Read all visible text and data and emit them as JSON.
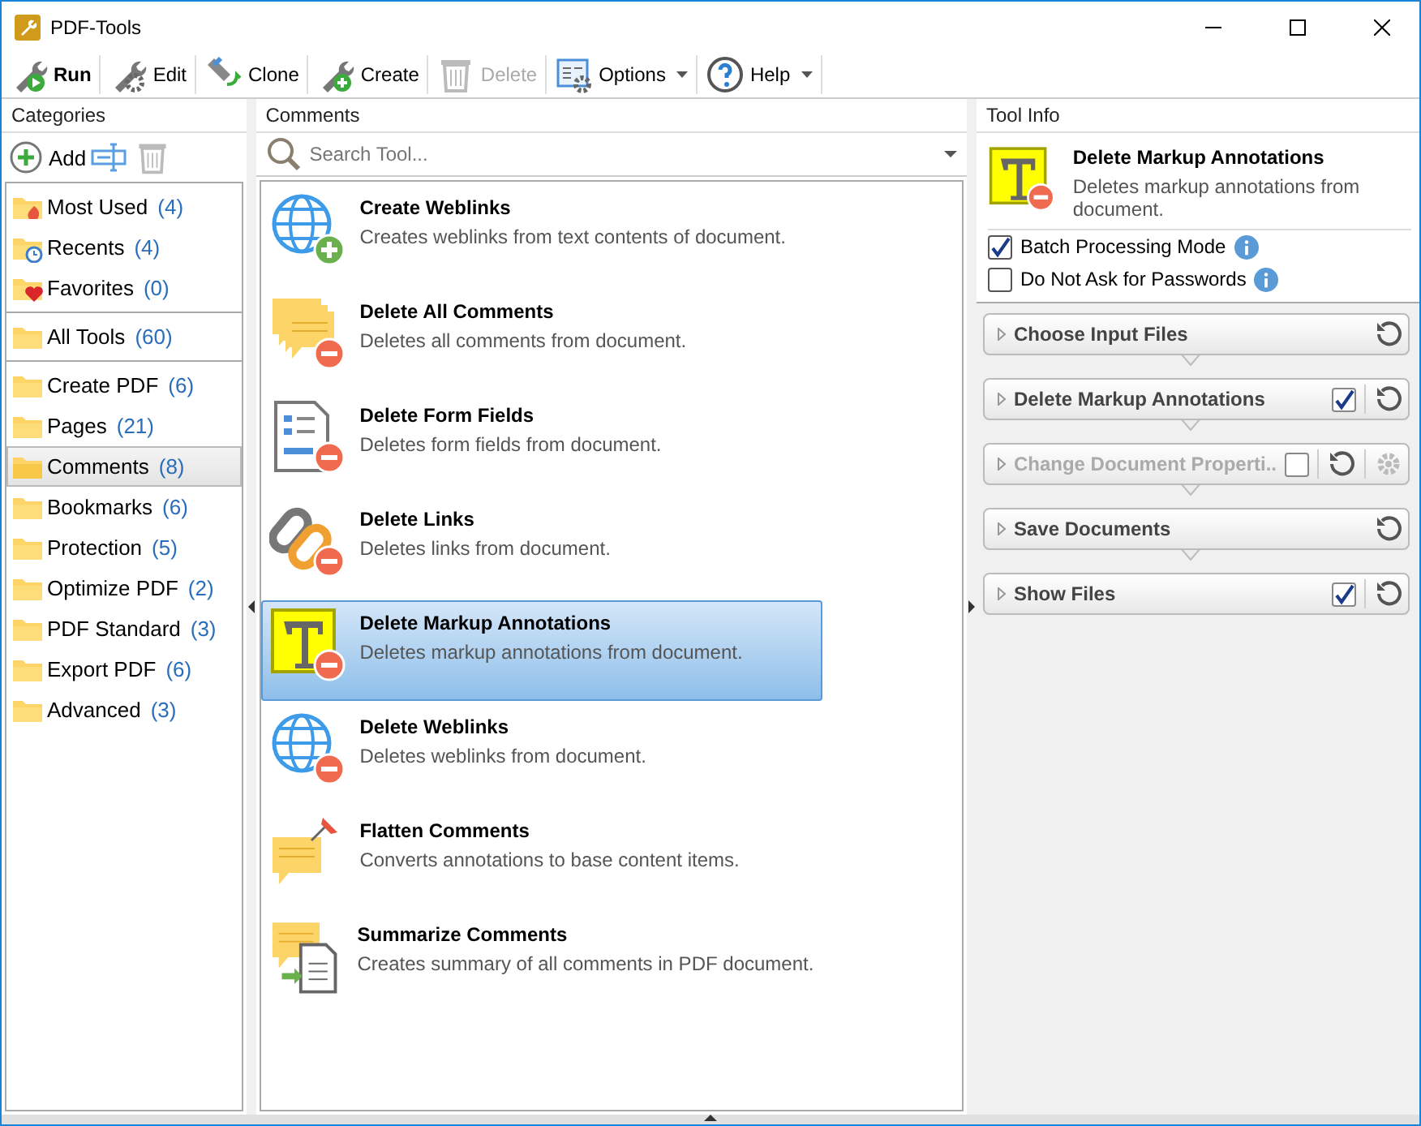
{
  "window": {
    "title": "PDF-Tools"
  },
  "toolbar": [
    {
      "label": "Run",
      "disabled": false,
      "dropdown": false,
      "bold": true
    },
    {
      "label": "Edit",
      "disabled": false,
      "dropdown": false,
      "bold": false
    },
    {
      "label": "Clone",
      "disabled": false,
      "dropdown": false,
      "bold": false
    },
    {
      "label": "Create",
      "disabled": false,
      "dropdown": false,
      "bold": false
    },
    {
      "label": "Delete",
      "disabled": true,
      "dropdown": false,
      "bold": false
    },
    {
      "label": "Options",
      "disabled": false,
      "dropdown": true,
      "bold": false
    },
    {
      "label": "Help",
      "disabled": false,
      "dropdown": true,
      "bold": false
    }
  ],
  "categories": {
    "title": "Categories",
    "add_label": "Add",
    "groups": [
      [
        {
          "name": "Most Used",
          "count": "(4)",
          "selected": false
        },
        {
          "name": "Recents",
          "count": "(4)",
          "selected": false
        },
        {
          "name": "Favorites",
          "count": "(0)",
          "selected": false
        }
      ],
      [
        {
          "name": "All Tools",
          "count": "(60)",
          "selected": false
        }
      ],
      [
        {
          "name": "Create PDF",
          "count": "(6)",
          "selected": false
        },
        {
          "name": "Pages",
          "count": "(21)",
          "selected": false
        },
        {
          "name": "Comments",
          "count": "(8)",
          "selected": true
        },
        {
          "name": "Bookmarks",
          "count": "(6)",
          "selected": false
        },
        {
          "name": "Protection",
          "count": "(5)",
          "selected": false
        },
        {
          "name": "Optimize PDF",
          "count": "(2)",
          "selected": false
        },
        {
          "name": "PDF Standard",
          "count": "(3)",
          "selected": false
        },
        {
          "name": "Export PDF",
          "count": "(6)",
          "selected": false
        },
        {
          "name": "Advanced",
          "count": "(3)",
          "selected": false
        }
      ]
    ]
  },
  "tools": {
    "title": "Comments",
    "search": {
      "placeholder": "Search Tool..."
    },
    "items": [
      {
        "name": "Create Weblinks",
        "description": "Creates weblinks from text contents of document.",
        "selected": false
      },
      {
        "name": "Delete All Comments",
        "description": "Deletes all comments from document.",
        "selected": false
      },
      {
        "name": "Delete Form Fields",
        "description": "Deletes form fields from document.",
        "selected": false
      },
      {
        "name": "Delete Links",
        "description": "Deletes links from document.",
        "selected": false
      },
      {
        "name": "Delete Markup Annotations",
        "description": "Deletes markup annotations from document.",
        "selected": true
      },
      {
        "name": "Delete Weblinks",
        "description": "Deletes weblinks from document.",
        "selected": false
      },
      {
        "name": "Flatten Comments",
        "description": "Converts annotations to base content items.",
        "selected": false
      },
      {
        "name": "Summarize Comments",
        "description": "Creates summary of all comments in PDF document.",
        "selected": false
      }
    ]
  },
  "tool_info": {
    "title": "Tool Info",
    "name": "Delete Markup Annotations",
    "description": "Deletes markup annotations from document.",
    "options": [
      {
        "label": "Batch Processing Mode",
        "checked": true
      },
      {
        "label": "Do Not Ask for Passwords",
        "checked": false
      }
    ],
    "steps": [
      {
        "label": "Choose Input Files",
        "disabled": false,
        "kind": "plain"
      },
      {
        "label": "Delete Markup Annotations",
        "disabled": false,
        "kind": "checkable",
        "checked": true
      },
      {
        "label": "Change Document Properti..",
        "disabled": true,
        "kind": "configurable",
        "checked": false
      },
      {
        "label": "Save Documents",
        "disabled": false,
        "kind": "plain"
      },
      {
        "label": "Show Files",
        "disabled": false,
        "kind": "checkable",
        "checked": true
      }
    ]
  }
}
